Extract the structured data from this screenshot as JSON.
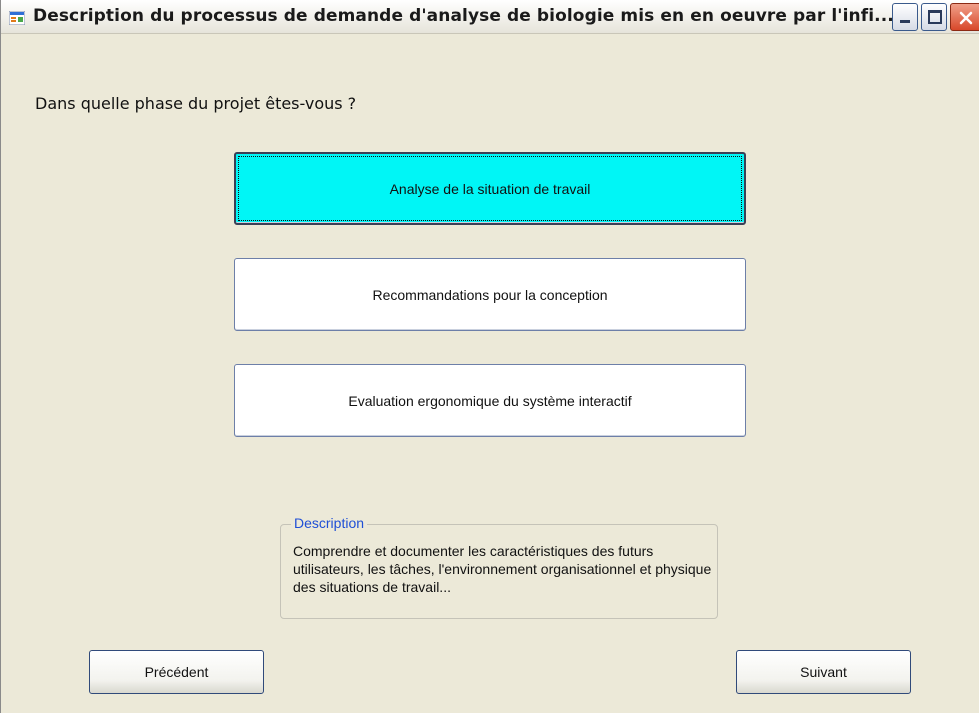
{
  "window": {
    "title": "Description du processus de demande d'analyse de biologie mis en en oeuvre par l'infi...",
    "icon": "app-form-icon",
    "controls": [
      "minimize-icon",
      "maximize-icon",
      "close-icon"
    ]
  },
  "question": "Dans quelle phase du projet êtes-vous ?",
  "phases": [
    {
      "label": "Analyse de la situation de travail",
      "selected": true
    },
    {
      "label": "Recommandations pour la conception",
      "selected": false
    },
    {
      "label": "Evaluation ergonomique du système interactif",
      "selected": false
    }
  ],
  "description": {
    "legend": "Description",
    "text": "Comprendre et documenter les caractéristiques des futurs utilisateurs, les tâches, l'environnement organisationnel et physique des situations de travail..."
  },
  "navigation": {
    "previous_label": "Précédent",
    "next_label": "Suivant"
  },
  "colors": {
    "selected_phase": "#00f6f6",
    "window_background": "#ece9d8",
    "legend_text": "#1f4fd6",
    "close_button": "#d8482a"
  }
}
